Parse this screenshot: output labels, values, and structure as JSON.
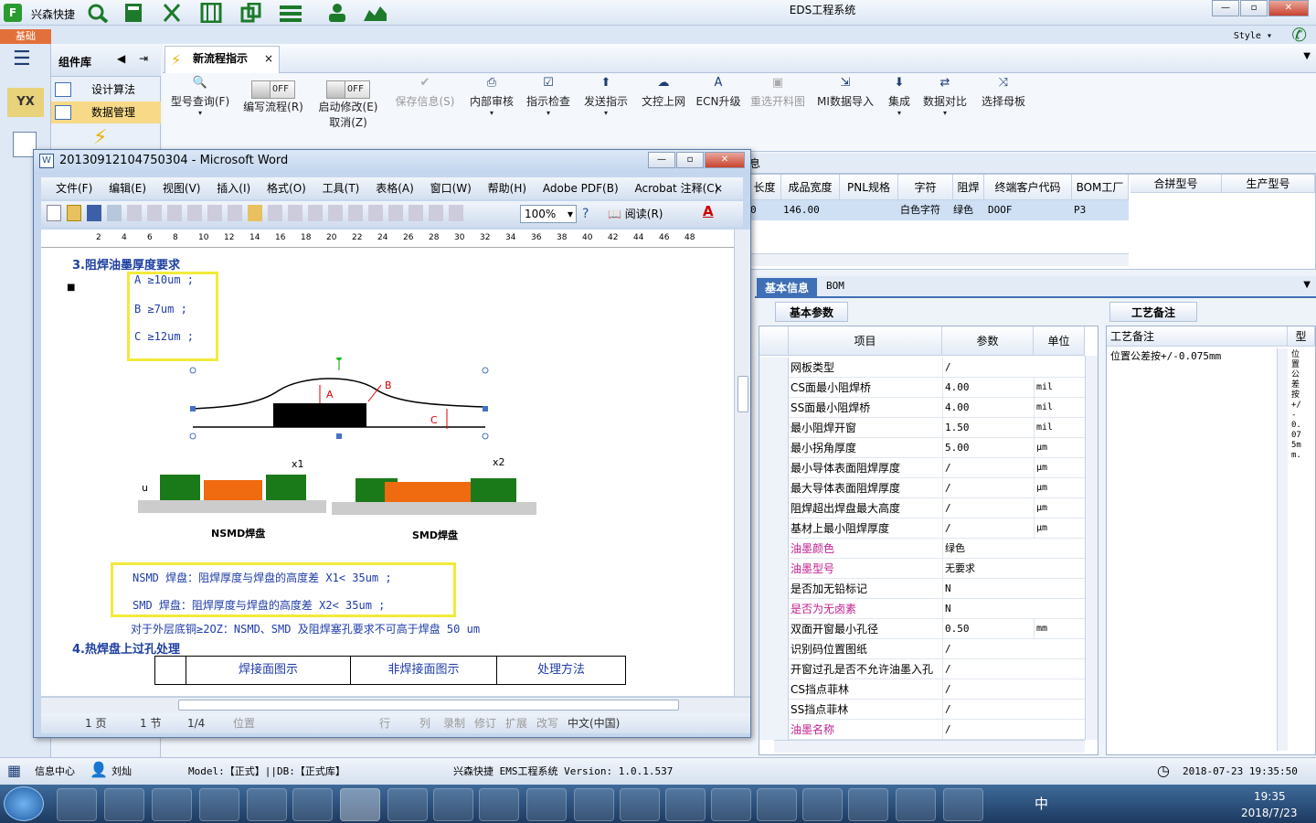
{
  "app": {
    "name": "兴森快捷",
    "window_title": "EDS工程系统",
    "skin_tab": "基础",
    "style_label": "Style"
  },
  "component_panel": {
    "title": "组件库",
    "items": [
      "设计算法",
      "数据管理"
    ]
  },
  "doc_tab": {
    "label": "新流程指示"
  },
  "ribbon": {
    "buttons": [
      {
        "label": "型号查询(F)",
        "icon": "search-icon"
      },
      {
        "label": "编写流程(R)",
        "toggle": "OFF"
      },
      {
        "label": "启动修改(E)",
        "sub": "取消(Z)",
        "toggle": "OFF"
      },
      {
        "label": "保存信息(S)",
        "disabled": true
      },
      {
        "label": "内部审核"
      },
      {
        "label": "指示检查"
      },
      {
        "label": "发送指示"
      },
      {
        "label": "文控上网"
      },
      {
        "label": "ECN升级"
      },
      {
        "label": "重选开料图",
        "disabled": true
      },
      {
        "label": "MI数据导入"
      },
      {
        "label": "集成"
      },
      {
        "label": "数据对比"
      },
      {
        "label": "选择母板"
      }
    ]
  },
  "top_grid": {
    "partial_tab": "息",
    "headers": [
      "长度",
      "成品宽度",
      "PNL规格",
      "字符",
      "阻焊",
      "终端客户代码",
      "BOM工厂",
      "合拼型号",
      "生产型号"
    ],
    "row": [
      "0",
      "146.00",
      "",
      "白色字符",
      "绿色",
      "DOOF",
      "P3",
      "",
      ""
    ]
  },
  "info_tabs": [
    "基本信息",
    "BOM"
  ],
  "basic_params": {
    "tab": "基本参数",
    "headers": [
      "项目",
      "参数",
      "单位"
    ],
    "rows": [
      {
        "item": "网板类型",
        "value": "/",
        "unit": "",
        "pink": false
      },
      {
        "item": "CS面最小阻焊桥",
        "value": "4.00",
        "unit": "mil",
        "pink": false
      },
      {
        "item": "SS面最小阻焊桥",
        "value": "4.00",
        "unit": "mil",
        "pink": false
      },
      {
        "item": "最小阻焊开窗",
        "value": "1.50",
        "unit": "mil",
        "pink": false
      },
      {
        "item": "最小拐角厚度",
        "value": "5.00",
        "unit": "μm",
        "pink": false
      },
      {
        "item": "最小导体表面阻焊厚度",
        "value": "/",
        "unit": "μm",
        "pink": false
      },
      {
        "item": "最大导体表面阻焊厚度",
        "value": "/",
        "unit": "μm",
        "pink": false
      },
      {
        "item": "阻焊超出焊盘最大高度",
        "value": "/",
        "unit": "μm",
        "pink": false
      },
      {
        "item": "基材上最小阻焊厚度",
        "value": "/",
        "unit": "μm",
        "pink": false
      },
      {
        "item": "油墨颜色",
        "value": "绿色",
        "unit": "",
        "pink": true
      },
      {
        "item": "油墨型号",
        "value": "无要求",
        "unit": "",
        "pink": true
      },
      {
        "item": "是否加无铅标记",
        "value": "N",
        "unit": "",
        "pink": false
      },
      {
        "item": "是否为无卤素",
        "value": "N",
        "unit": "",
        "pink": true
      },
      {
        "item": "双面开窗最小孔径",
        "value": "0.50",
        "unit": "mm",
        "pink": false
      },
      {
        "item": "识别码位置图纸",
        "value": "/",
        "unit": "",
        "pink": false
      },
      {
        "item": "开窗过孔是否不允许油墨入孔",
        "value": "/",
        "unit": "",
        "pink": false
      },
      {
        "item": "CS挡点菲林",
        "value": "/",
        "unit": "",
        "pink": false
      },
      {
        "item": "SS挡点菲林",
        "value": "/",
        "unit": "",
        "pink": false
      },
      {
        "item": "油墨名称",
        "value": "/",
        "unit": "",
        "pink": true
      }
    ]
  },
  "process_notes": {
    "tab": "工艺备注",
    "header": "工艺备注",
    "header2": "型",
    "value": "位置公差按+/-0.075mm",
    "vertical": "位置公差按+/-0.075mm."
  },
  "status": {
    "info_center": "信息中心",
    "user": "刘灿",
    "model": "Model:【正式】||DB:【正式库】",
    "system": "兴森快捷 EMS工程系统 Version: 1.0.1.537",
    "datetime": "2018-07-23 19:35:50"
  },
  "taskbar": {
    "time": "19:35",
    "date": "2018/7/23",
    "ime": "中"
  },
  "word": {
    "title": "20130912104750304 - Microsoft Word",
    "menu": [
      "文件(F)",
      "编辑(E)",
      "视图(V)",
      "插入(I)",
      "格式(O)",
      "工具(T)",
      "表格(A)",
      "窗口(W)",
      "帮助(H)",
      "Adobe PDF(B)",
      "Acrobat 注释(C)"
    ],
    "zoom": "100%",
    "read_label": "阅读(R)",
    "ruler_ticks": [
      "2",
      "4",
      "6",
      "8",
      "10",
      "12",
      "14",
      "16",
      "18",
      "20",
      "22",
      "24",
      "26",
      "28",
      "30",
      "32",
      "34",
      "36",
      "38",
      "40",
      "42",
      "44",
      "46",
      "48"
    ],
    "heading3": "3.阻焊油墨厚度要求",
    "req_a": "A ≥10um ;",
    "req_b": "B ≥7um ;",
    "req_c": "C ≥12um ;",
    "fig_a": "A",
    "fig_b": "B",
    "fig_c": "C",
    "fig_x1": "x1",
    "fig_x2": "x2",
    "fig_u": "u",
    "fig_nsmd": "NSMD焊盘",
    "fig_smd": "SMD焊盘",
    "nsmd_text": "NSMD 焊盘：阻焊厚度与焊盘的高度差 X1< 35um ;",
    "smd_text": "SMD 焊盘：阻焊厚度与焊盘的高度差 X2< 35um ;",
    "outer_text": "对于外层底铜≥2OZ：NSMD、SMD 及阻焊塞孔要求不可高于焊盘 50 um",
    "heading4": "4.热焊盘上过孔处理",
    "table_headers": [
      "焊接面图示",
      "非焊接面图示",
      "处理方法"
    ],
    "status_items": [
      "1 页",
      "1 节",
      "1/4",
      "位置",
      "行",
      "列",
      "录制",
      "修订",
      "扩展",
      "改写",
      "中文(中国)"
    ]
  }
}
